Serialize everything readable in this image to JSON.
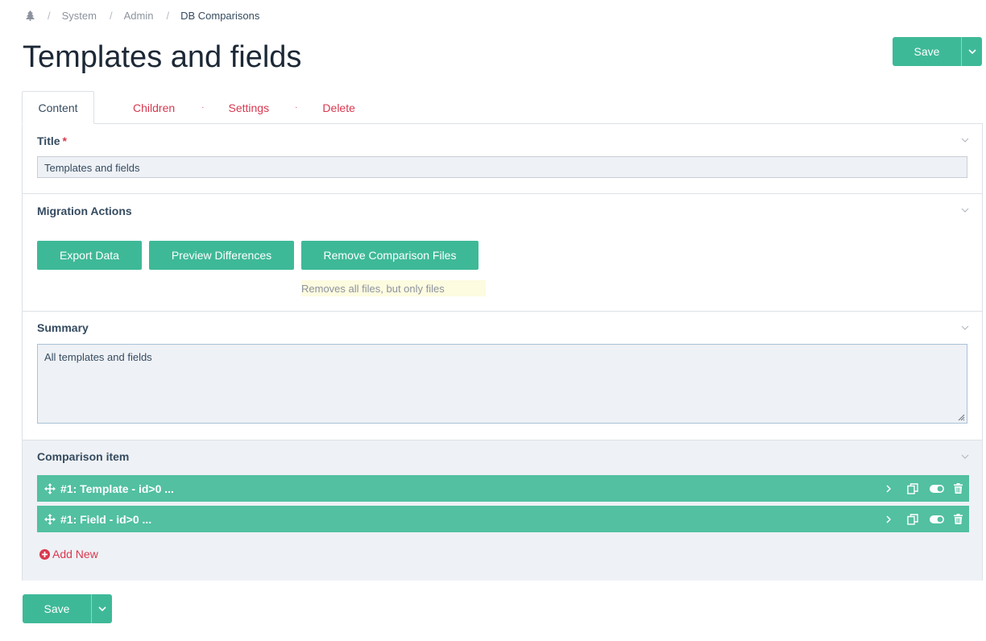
{
  "breadcrumb": {
    "home_icon": "tree-icon",
    "items": [
      "System",
      "Admin",
      "DB Comparisons"
    ],
    "separator": "/"
  },
  "page_title": "Templates and fields",
  "save_label": "Save",
  "tabs": {
    "active": "Content",
    "links": [
      "Children",
      "Settings",
      "Delete"
    ],
    "dot": "·"
  },
  "title_field": {
    "label": "Title",
    "required_mark": "*",
    "value": "Templates and fields"
  },
  "migration": {
    "label": "Migration Actions",
    "buttons": [
      "Export Data",
      "Preview Differences",
      "Remove Comparison Files"
    ],
    "note": "Removes all files, but only files"
  },
  "summary": {
    "label": "Summary",
    "value": "All templates and fields"
  },
  "comparison": {
    "label": "Comparison item",
    "items": [
      {
        "title": "#1: Template - id>0 ..."
      },
      {
        "title": "#1: Field - id>0 ..."
      }
    ],
    "add_new": "Add New"
  },
  "colors": {
    "accent": "#3eb998",
    "row": "#52c0a1",
    "link": "#d9384f"
  }
}
